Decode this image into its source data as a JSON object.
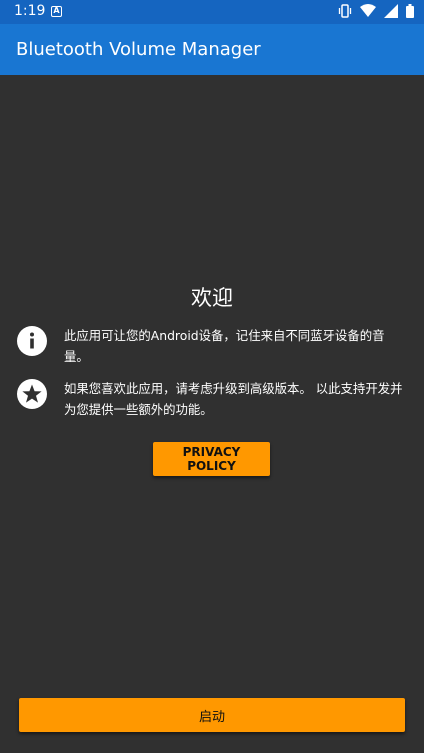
{
  "status_bar": {
    "time": "1:19",
    "icons": [
      "notification-a-icon",
      "vibrate-icon",
      "wifi-icon",
      "signal-icon",
      "battery-icon"
    ]
  },
  "app_bar": {
    "title": "Bluetooth Volume Manager"
  },
  "main": {
    "welcome_title": "欢迎",
    "info_text": "此应用可让您的Android设备，记住来自不同蓝牙设备的音量。",
    "info_icon": "info-icon",
    "premium_text": "如果您喜欢此应用，请考虑升级到高级版本。 以此支持开发并为您提供一些额外的功能。",
    "premium_icon": "star-icon",
    "privacy_button": "PRIVACY POLICY",
    "start_button": "启动"
  },
  "colors": {
    "status_bar": "#1565c0",
    "app_bar": "#1976d2",
    "background": "#303030",
    "accent": "#ff9800"
  }
}
